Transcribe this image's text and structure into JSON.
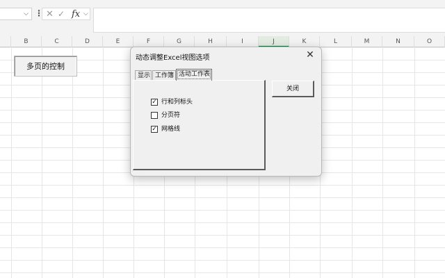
{
  "formula_bar": {
    "cancel_glyph": "✕",
    "enter_glyph": "✓",
    "fx_label": "fx",
    "more_glyph": "⋮",
    "chevron_glyph": "⌵"
  },
  "columns": [
    "B",
    "C",
    "D",
    "E",
    "F",
    "G",
    "H",
    "I",
    "J",
    "K",
    "L",
    "M",
    "N",
    "O"
  ],
  "active_column": "J",
  "sheet_button": {
    "label": "多页的控制"
  },
  "dialog": {
    "title": "动态调整Excel视图选项",
    "close_glyph": "✕",
    "tabs": [
      {
        "label": "显示",
        "selected": false
      },
      {
        "label": "工作簿",
        "selected": false
      },
      {
        "label": "活动工作表",
        "selected": true
      }
    ],
    "checkboxes": [
      {
        "label": "行和列标头",
        "checked": true,
        "mark": "✓"
      },
      {
        "label": "分页符",
        "checked": false,
        "mark": ""
      },
      {
        "label": "网格线",
        "checked": true,
        "mark": "✓"
      }
    ],
    "close_button_label": "关闭"
  },
  "colors": {
    "accent": "#1e7145",
    "grid_line": "#e6e6e6",
    "header_bg": "#f3f3f3",
    "dialog_bg": "#f0f0f0"
  }
}
